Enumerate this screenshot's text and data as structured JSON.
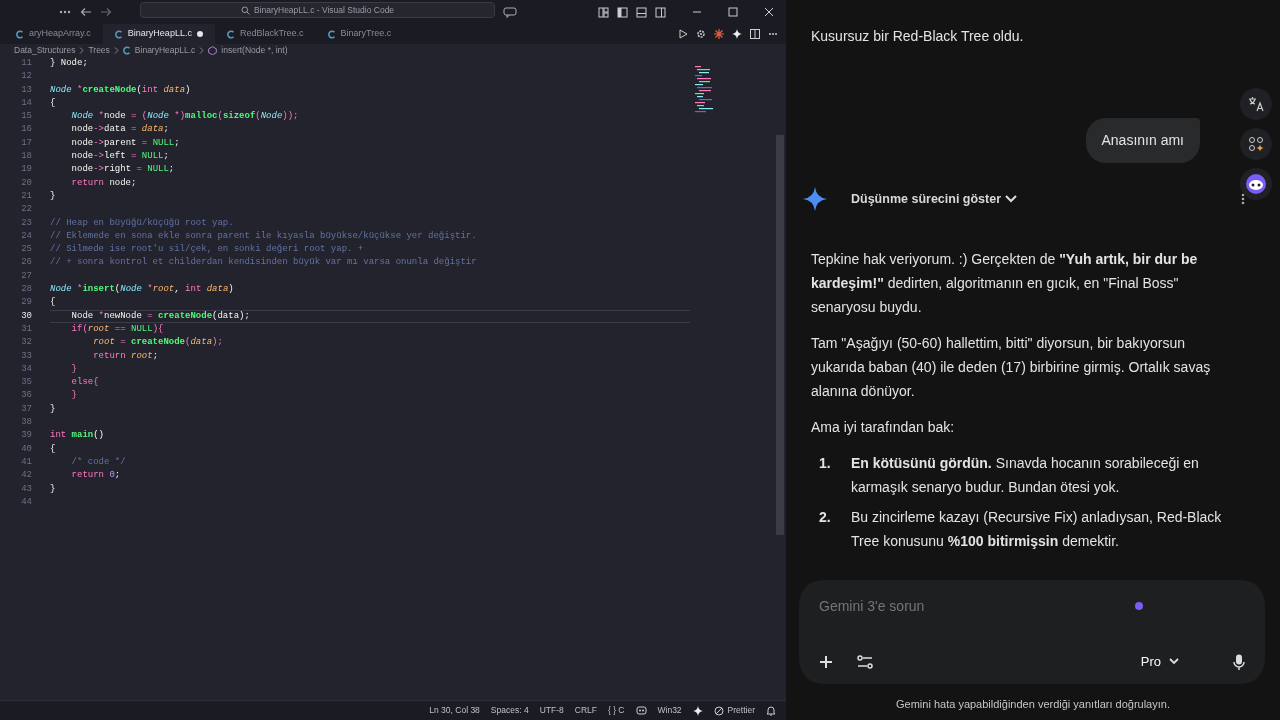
{
  "editor": {
    "window_title": "BinaryHeapLL.c - Visual Studio Code",
    "tabs": [
      {
        "label": "aryHeapArray.c",
        "selected": false,
        "modified": false
      },
      {
        "label": "BinaryHeapLL.c",
        "selected": true,
        "modified": true
      },
      {
        "label": "RedBlackTree.c",
        "selected": false,
        "modified": false
      },
      {
        "label": "BinaryTree.c",
        "selected": false,
        "modified": false
      }
    ],
    "breadcrumb": [
      {
        "label": "Data_Structures",
        "kind": "folder"
      },
      {
        "label": "Trees",
        "kind": "folder"
      },
      {
        "label": "BinaryHeapLL.c",
        "kind": "file"
      },
      {
        "label": "insert(Node *, int)",
        "kind": "symbol"
      }
    ],
    "lines": [
      {
        "number": "11",
        "current": false,
        "tokens": [
          {
            "text": "} Node;",
            "kind": "plain"
          }
        ]
      },
      {
        "number": "12",
        "current": false
      },
      {
        "number": "13",
        "current": false,
        "tokens": [
          {
            "text": "Node",
            "kind": "type"
          },
          {
            "text": " *",
            "kind": "op"
          },
          {
            "text": "createNode",
            "kind": "fn"
          },
          {
            "text": "(",
            "kind": "plain"
          },
          {
            "text": "int",
            "kind": "kw"
          },
          {
            "text": " data",
            "kind": "param"
          },
          {
            "text": ")",
            "kind": "plain"
          }
        ]
      },
      {
        "number": "14",
        "current": false,
        "tokens": [
          {
            "text": "{",
            "kind": "plain"
          }
        ]
      },
      {
        "number": "15",
        "current": false,
        "tokens": [
          {
            "text": "    Node",
            "kind": "type"
          },
          {
            "text": " *",
            "kind": "op"
          },
          {
            "text": "node ",
            "kind": "plain"
          },
          {
            "text": "=",
            "kind": "op"
          },
          {
            "text": " (",
            "kind": "op"
          },
          {
            "text": "Node",
            "kind": "type"
          },
          {
            "text": " *)",
            "kind": "op"
          },
          {
            "text": "malloc",
            "kind": "fn"
          },
          {
            "text": "(",
            "kind": "op"
          },
          {
            "text": "sizeof",
            "kind": "fn"
          },
          {
            "text": "(",
            "kind": "op"
          },
          {
            "text": "Node",
            "kind": "type"
          },
          {
            "text": "));",
            "kind": "op"
          }
        ]
      },
      {
        "number": "16",
        "current": false,
        "tokens": [
          {
            "text": "    node",
            "kind": "plain"
          },
          {
            "text": "->",
            "kind": "op"
          },
          {
            "text": "data ",
            "kind": "plain"
          },
          {
            "text": "=",
            "kind": "op"
          },
          {
            "text": " data",
            "kind": "param"
          },
          {
            "text": ";",
            "kind": "plain"
          }
        ]
      },
      {
        "number": "17",
        "current": false,
        "tokens": [
          {
            "text": "    node",
            "kind": "plain"
          },
          {
            "text": "->",
            "kind": "op"
          },
          {
            "text": "parent ",
            "kind": "plain"
          },
          {
            "text": "=",
            "kind": "op"
          },
          {
            "text": " NULL",
            "kind": "const"
          },
          {
            "text": ";",
            "kind": "plain"
          }
        ]
      },
      {
        "number": "18",
        "current": false,
        "tokens": [
          {
            "text": "    node",
            "kind": "plain"
          },
          {
            "text": "->",
            "kind": "op"
          },
          {
            "text": "left ",
            "kind": "plain"
          },
          {
            "text": "=",
            "kind": "op"
          },
          {
            "text": " NULL",
            "kind": "const"
          },
          {
            "text": ";",
            "kind": "plain"
          }
        ]
      },
      {
        "number": "19",
        "current": false,
        "tokens": [
          {
            "text": "    node",
            "kind": "plain"
          },
          {
            "text": "->",
            "kind": "op"
          },
          {
            "text": "right ",
            "kind": "plain"
          },
          {
            "text": "=",
            "kind": "op"
          },
          {
            "text": " NULL",
            "kind": "const"
          },
          {
            "text": ";",
            "kind": "plain"
          }
        ]
      },
      {
        "number": "20",
        "current": false,
        "tokens": [
          {
            "text": "    return",
            "kind": "kw"
          },
          {
            "text": " node;",
            "kind": "plain"
          }
        ]
      },
      {
        "number": "21",
        "current": false,
        "tokens": [
          {
            "text": "}",
            "kind": "plain"
          }
        ]
      },
      {
        "number": "22",
        "current": false
      },
      {
        "number": "23",
        "current": false,
        "tokens": [
          {
            "text": "// Heap en büyüğü/küçüğü root yap.",
            "kind": "comment"
          }
        ]
      },
      {
        "number": "24",
        "current": false,
        "tokens": [
          {
            "text": "// Eklemede en sona ekle sonra parent ile kıyasla büyükse/küçükse yer değiştir.",
            "kind": "comment"
          }
        ]
      },
      {
        "number": "25",
        "current": false,
        "tokens": [
          {
            "text": "// Silmede ise root'u sil/çek, en sonki değeri root yap. +",
            "kind": "comment"
          }
        ]
      },
      {
        "number": "26",
        "current": false,
        "tokens": [
          {
            "text": "// + sonra kontrol et childerdan kendisinden büyük var mı varsa onunla değiştir",
            "kind": "comment"
          }
        ]
      },
      {
        "number": "27",
        "current": false
      },
      {
        "number": "28",
        "current": false,
        "tokens": [
          {
            "text": "Node",
            "kind": "type"
          },
          {
            "text": " *",
            "kind": "op"
          },
          {
            "text": "insert",
            "kind": "fn"
          },
          {
            "text": "(",
            "kind": "plain"
          },
          {
            "text": "Node",
            "kind": "type"
          },
          {
            "text": " *",
            "kind": "op"
          },
          {
            "text": "root",
            "kind": "param"
          },
          {
            "text": ", ",
            "kind": "plain"
          },
          {
            "text": "int",
            "kind": "kw"
          },
          {
            "text": " data",
            "kind": "param"
          },
          {
            "text": ")",
            "kind": "plain"
          }
        ]
      },
      {
        "number": "29",
        "current": false,
        "tokens": [
          {
            "text": "{",
            "kind": "plain"
          }
        ]
      },
      {
        "number": "30",
        "current": true,
        "tokens": [
          {
            "text": "    Node ",
            "kind": "plain"
          },
          {
            "text": "*",
            "kind": "op"
          },
          {
            "text": "newNode ",
            "kind": "plain"
          },
          {
            "text": "=",
            "kind": "op"
          },
          {
            "text": " createNode",
            "kind": "fn"
          },
          {
            "text": "(data);",
            "kind": "plain"
          }
        ]
      },
      {
        "number": "31",
        "current": false,
        "tokens": [
          {
            "text": "    if",
            "kind": "kw"
          },
          {
            "text": "(",
            "kind": "op"
          },
          {
            "text": "root",
            "kind": "param"
          },
          {
            "text": " == ",
            "kind": "op"
          },
          {
            "text": "NULL",
            "kind": "const"
          },
          {
            "text": "){",
            "kind": "op"
          }
        ]
      },
      {
        "number": "32",
        "current": false,
        "tokens": [
          {
            "text": "        root",
            "kind": "param"
          },
          {
            "text": " = ",
            "kind": "op"
          },
          {
            "text": "createNode",
            "kind": "fn"
          },
          {
            "text": "(",
            "kind": "op"
          },
          {
            "text": "data",
            "kind": "param"
          },
          {
            "text": ");",
            "kind": "op"
          }
        ]
      },
      {
        "number": "33",
        "current": false,
        "tokens": [
          {
            "text": "        return",
            "kind": "kw"
          },
          {
            "text": " root",
            "kind": "param"
          },
          {
            "text": ";",
            "kind": "plain"
          }
        ]
      },
      {
        "number": "34",
        "current": false,
        "tokens": [
          {
            "text": "    }",
            "kind": "kw"
          }
        ]
      },
      {
        "number": "35",
        "current": false,
        "tokens": [
          {
            "text": "    else{",
            "kind": "kw"
          }
        ]
      },
      {
        "number": "36",
        "current": false,
        "tokens": [
          {
            "text": "    }",
            "kind": "kw"
          }
        ]
      },
      {
        "number": "37",
        "current": false,
        "tokens": [
          {
            "text": "}",
            "kind": "plain"
          }
        ]
      },
      {
        "number": "38",
        "current": false
      },
      {
        "number": "39",
        "current": false,
        "tokens": [
          {
            "text": "int",
            "kind": "kw"
          },
          {
            "text": " main",
            "kind": "fn"
          },
          {
            "text": "()",
            "kind": "plain"
          }
        ]
      },
      {
        "number": "40",
        "current": false,
        "tokens": [
          {
            "text": "{",
            "kind": "plain"
          }
        ]
      },
      {
        "number": "41",
        "current": false,
        "tokens": [
          {
            "text": "    /* code */",
            "kind": "comment"
          }
        ]
      },
      {
        "number": "42",
        "current": false,
        "tokens": [
          {
            "text": "    return",
            "kind": "kw"
          },
          {
            "text": " 0",
            "kind": "num"
          },
          {
            "text": ";",
            "kind": "plain"
          }
        ]
      },
      {
        "number": "43",
        "current": false,
        "tokens": [
          {
            "text": "}",
            "kind": "plain"
          }
        ]
      },
      {
        "number": "44",
        "current": false
      }
    ],
    "status_bar": [
      "Ln 30, Col 38",
      "Spaces: 4",
      "UTF-8",
      "CRLF",
      "{ } C",
      "Win32",
      "Prettier"
    ]
  },
  "chat": {
    "earlier_reply": "Kusursuz bir Red-Black Tree oldu.",
    "user_message": "Anasının amı",
    "thinking_toggle": {
      "label": "Düşünme sürecini göster",
      "expanded": false
    },
    "paragraphs": [
      "Tepkine hak veriyorum. :) Gerçekten de **\"Yuh artık, bir dur be kardeşim!\"** dedirten, algoritmanın en gıcık, en \"Final Boss\" senaryosu buydu.",
      "Tam \"Aşağıyı (50-60) hallettim, bitti\" diyorsun, bir bakıyorsun yukarıda baban (40) ile deden (17) birbirine girmiş. Ortalık savaş alanına dönüyor.",
      "Ama iyi tarafından bak:"
    ],
    "list": [
      {
        "number": "1.",
        "text": "**En kötüsünü gördün.** Sınavda hocanın sorabileceği en karmaşık senaryo budur. Bundan ötesi yok."
      },
      {
        "number": "2.",
        "text": "Bu zincirleme kazayı (Recursive Fix) anladıysan, Red-Black Tree konusunu **%100 bitirmişsin** demektir."
      }
    ],
    "input": {
      "placeholder": "Gemini 3'e sorun",
      "model": "Pro"
    },
    "disclaimer": "Gemini hata yapabildiğinden verdiği yanıtları doğrulayın."
  }
}
